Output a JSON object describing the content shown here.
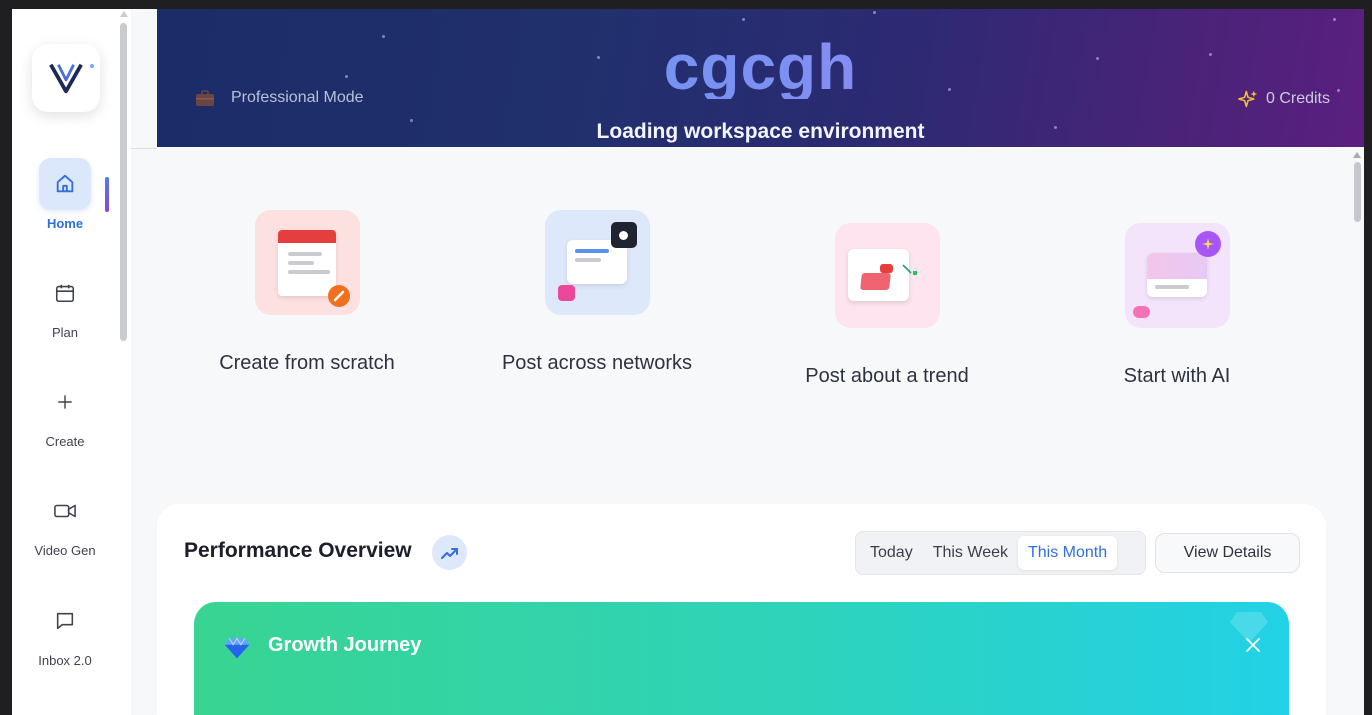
{
  "sidebar": {
    "items": [
      {
        "label": "Home",
        "icon": "home-icon",
        "active": true
      },
      {
        "label": "Plan",
        "icon": "calendar-icon"
      },
      {
        "label": "Create",
        "icon": "plus-icon"
      },
      {
        "label": "Video Gen",
        "icon": "video-icon"
      },
      {
        "label": "Inbox 2.0",
        "icon": "chat-icon"
      }
    ]
  },
  "banner": {
    "brand": "cgcgh",
    "subtitle": "Loading workspace environment",
    "mode_label": "Professional Mode",
    "credits_label": "0 Credits"
  },
  "quick_actions": [
    {
      "label": "Create from scratch",
      "tile_color": "#fde0e0"
    },
    {
      "label": "Post across networks",
      "tile_color": "#dde8fb"
    },
    {
      "label": "Post about a trend",
      "tile_color": "#fde4ee"
    },
    {
      "label": "Start with AI",
      "tile_color": "#f3e3fb"
    }
  ],
  "performance": {
    "title": "Performance Overview",
    "ranges": [
      "Today",
      "This Week",
      "This Month"
    ],
    "selected_range": "This Month",
    "view_details_label": "View Details",
    "growth_title": "Growth Journey"
  },
  "colors": {
    "accent": "#2f6fdf",
    "growth_start": "#38d492",
    "growth_end": "#22d2e6"
  }
}
